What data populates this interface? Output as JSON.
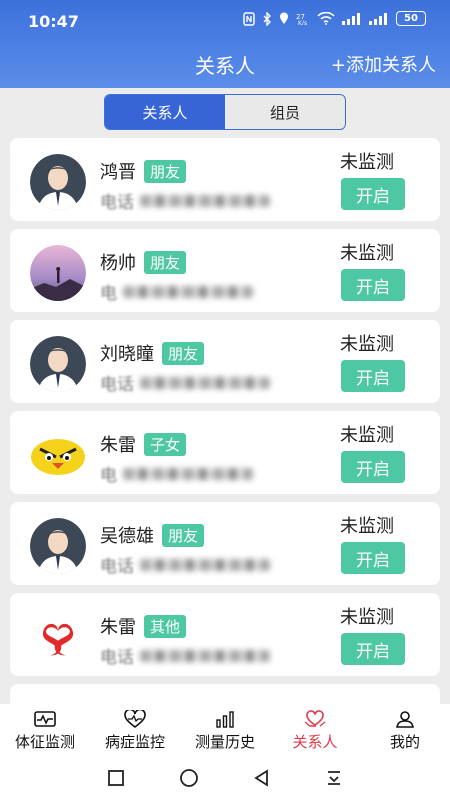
{
  "status_bar": {
    "time": "10:47",
    "battery": "50"
  },
  "header": {
    "title": "关系人",
    "add_label": "+添加关系人"
  },
  "segment": {
    "tabs": [
      "关系人",
      "组员"
    ],
    "active_index": 0
  },
  "contacts": [
    {
      "name": "鸿晋",
      "relation": "朋友",
      "phone_label": "电话",
      "status": "未监测",
      "action": "开启",
      "avatar": "person-avatar"
    },
    {
      "name": "杨帅",
      "relation": "朋友",
      "phone_label": "电",
      "status": "未监测",
      "action": "开启",
      "avatar": "sunset-avatar"
    },
    {
      "name": "刘晓瞳",
      "relation": "朋友",
      "phone_label": "电话",
      "status": "未监测",
      "action": "开启",
      "avatar": "person-avatar"
    },
    {
      "name": "朱雷",
      "relation": "子女",
      "phone_label": "电",
      "status": "未监测",
      "action": "开启",
      "avatar": "bird-avatar"
    },
    {
      "name": "吴德雄",
      "relation": "朋友",
      "phone_label": "电话",
      "status": "未监测",
      "action": "开启",
      "avatar": "person-avatar"
    },
    {
      "name": "朱雷",
      "relation": "其他",
      "phone_label": "电话",
      "status": "未监测",
      "action": "开启",
      "avatar": "logo-avatar"
    }
  ],
  "tabbar": {
    "items": [
      {
        "label": "体征监测",
        "icon": "ecg-icon"
      },
      {
        "label": "病症监控",
        "icon": "heart-pulse-icon"
      },
      {
        "label": "测量历史",
        "icon": "bar-chart-icon"
      },
      {
        "label": "关系人",
        "icon": "heart-hands-icon"
      },
      {
        "label": "我的",
        "icon": "user-icon"
      }
    ],
    "active_index": 3,
    "active_color": "#e03b4b"
  },
  "colors": {
    "header": "#3c71db",
    "accent_green": "#4ec7a3",
    "segment_active": "#3765d6"
  }
}
